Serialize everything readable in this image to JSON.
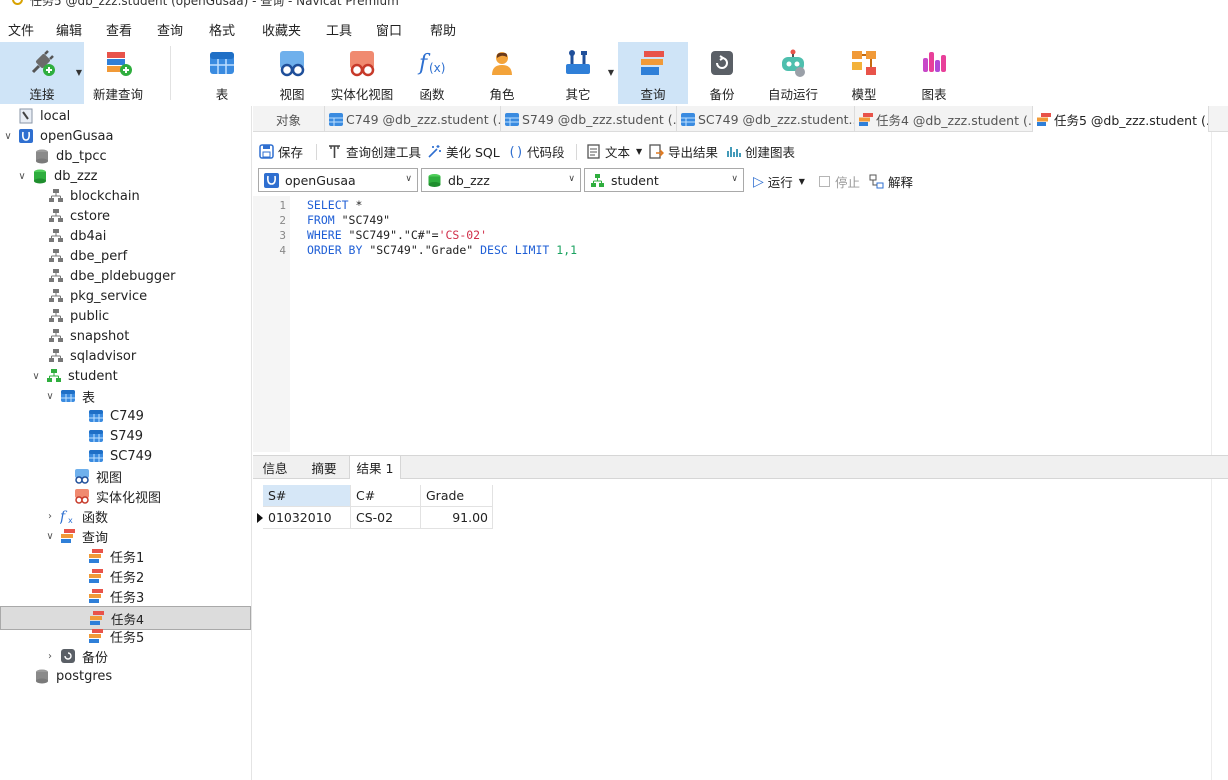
{
  "window": {
    "title": "任务5 @db_zzz.student (openGusaa) - 查询 - Navicat Premium"
  },
  "menu": [
    "文件",
    "编辑",
    "查看",
    "查询",
    "格式",
    "收藏夹",
    "工具",
    "窗口",
    "帮助"
  ],
  "toolbar": {
    "connect": "连接",
    "new_query": "新建查询",
    "table": "表",
    "view": "视图",
    "mat_view": "实体化视图",
    "function": "函数",
    "role": "角色",
    "other": "其它",
    "query": "查询",
    "backup": "备份",
    "automation": "自动运行",
    "model": "模型",
    "chart": "图表"
  },
  "tree": {
    "local": "local",
    "openGusaa": "openGusaa",
    "db_tpcc": "db_tpcc",
    "db_zzz": "db_zzz",
    "schemas": [
      "blockchain",
      "cstore",
      "db4ai",
      "dbe_perf",
      "dbe_pldebugger",
      "pkg_service",
      "public",
      "snapshot",
      "sqladvisor"
    ],
    "student": "student",
    "tables_label": "表",
    "tables": [
      "C749",
      "S749",
      "SC749"
    ],
    "views_label": "视图",
    "mat_views_label": "实体化视图",
    "functions_label": "函数",
    "queries_label": "查询",
    "queries": [
      "任务1",
      "任务2",
      "任务3",
      "任务4",
      "任务5"
    ],
    "backup_label": "备份",
    "postgres": "postgres"
  },
  "tabs": {
    "objects": "对象",
    "items": [
      "C749 @db_zzz.student (...",
      "S749 @db_zzz.student (...",
      "SC749 @db_zzz.student...",
      "任务4 @db_zzz.student (...",
      "任务5 @db_zzz.student (..."
    ]
  },
  "qtoolbar": {
    "save": "保存",
    "builder": "查询创建工具",
    "beautify": "美化 SQL",
    "snippet": "代码段",
    "text": "文本",
    "export": "导出结果",
    "create_chart": "创建图表"
  },
  "selectors": {
    "connection": "openGusaa",
    "database": "db_zzz",
    "schema": "student",
    "run": "运行",
    "stop": "停止",
    "explain": "解释"
  },
  "editor": {
    "line_numbers": [
      "1",
      "2",
      "3",
      "4"
    ],
    "l1_kw": "SELECT",
    "l1_rest": " *",
    "l2_kw": "FROM",
    "l2_rest": " \"SC749\"",
    "l3_kw": "WHERE",
    "l3_mid": " \"SC749\".\"C#\"=",
    "l3_str": "'CS-02'",
    "l4_kw": "ORDER BY",
    "l4_mid": " \"SC749\".\"Grade\" ",
    "l4_kw2": "DESC LIMIT",
    "l4_num": " 1,1"
  },
  "results": {
    "tabs": [
      "信息",
      "摘要",
      "结果 1"
    ],
    "columns": [
      "S#",
      "C#",
      "Grade"
    ],
    "rows": [
      [
        "01032010",
        "CS-02",
        "91.00"
      ]
    ]
  },
  "colors": {
    "accent": "#cfe4f7",
    "keyword": "#1f5fd6",
    "string": "#d02f4a",
    "number": "#1aa260"
  }
}
